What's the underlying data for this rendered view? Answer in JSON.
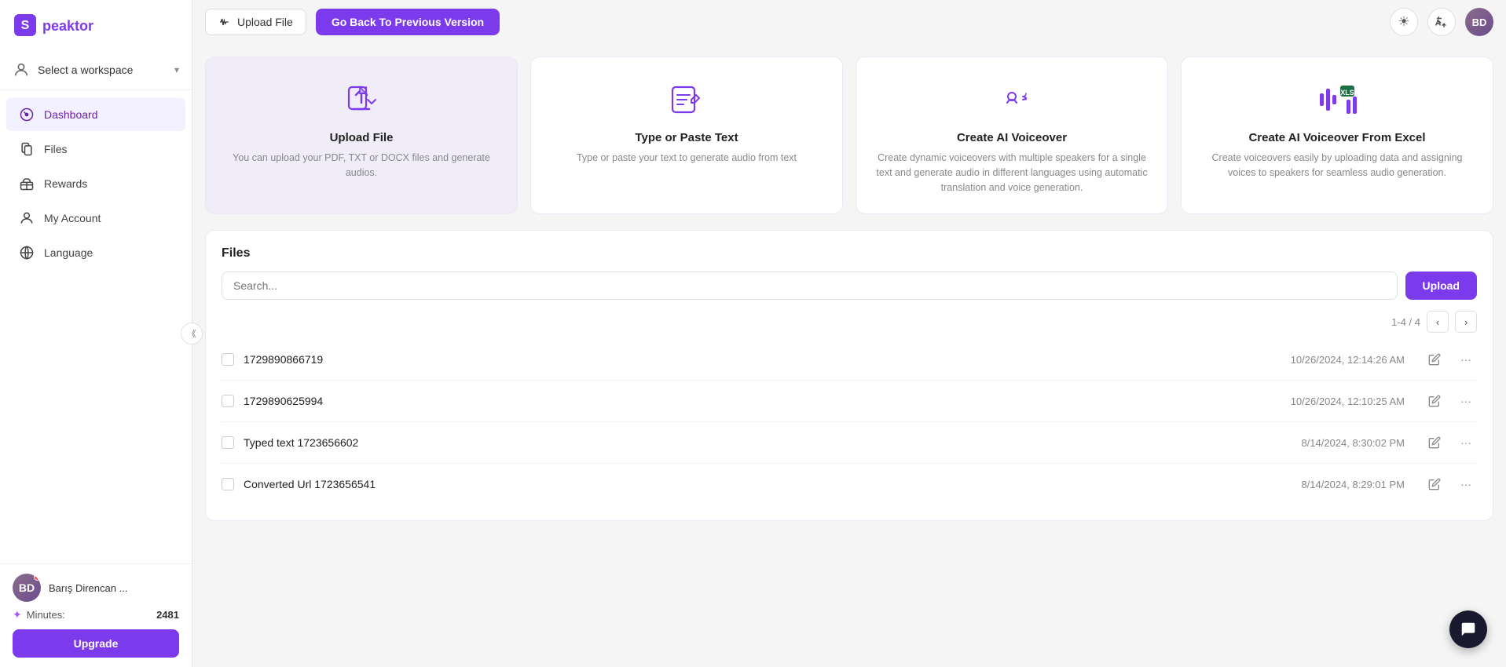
{
  "app": {
    "name": "Speaktor"
  },
  "sidebar": {
    "workspace_label": "Select a workspace",
    "nav_items": [
      {
        "id": "dashboard",
        "label": "Dashboard",
        "active": true
      },
      {
        "id": "files",
        "label": "Files",
        "active": false
      },
      {
        "id": "rewards",
        "label": "Rewards",
        "active": false
      },
      {
        "id": "my-account",
        "label": "My Account",
        "active": false
      },
      {
        "id": "language",
        "label": "Language",
        "active": false
      }
    ],
    "user": {
      "name": "Barış Direncan ...",
      "initials": "BD"
    },
    "minutes_label": "Minutes:",
    "minutes_value": "2481",
    "upgrade_label": "Upgrade"
  },
  "topbar": {
    "upload_file_label": "Upload File",
    "go_back_label": "Go Back To Previous Version"
  },
  "feature_cards": [
    {
      "id": "upload-file",
      "title": "Upload File",
      "description": "You can upload your PDF, TXT or DOCX files and generate audios."
    },
    {
      "id": "type-paste",
      "title": "Type or Paste Text",
      "description": "Type or paste your text to generate audio from text"
    },
    {
      "id": "ai-voiceover",
      "title": "Create AI Voiceover",
      "description": "Create dynamic voiceovers with multiple speakers for a single text and generate audio in different languages using automatic translation and voice generation."
    },
    {
      "id": "ai-voiceover-excel",
      "title": "Create AI Voiceover From Excel",
      "description": "Create voiceovers easily by uploading data and assigning voices to speakers for seamless audio generation."
    }
  ],
  "files_section": {
    "title": "Files",
    "search_placeholder": "Search...",
    "upload_label": "Upload",
    "pagination": "1-4 / 4",
    "files": [
      {
        "id": "1",
        "name": "1729890866719",
        "date": "10/26/2024, 12:14:26 AM"
      },
      {
        "id": "2",
        "name": "1729890625994",
        "date": "10/26/2024, 12:10:25 AM"
      },
      {
        "id": "3",
        "name": "Typed text 1723656602",
        "date": "8/14/2024, 8:30:02 PM"
      },
      {
        "id": "4",
        "name": "Converted Url 1723656541",
        "date": "8/14/2024, 8:29:01 PM"
      }
    ]
  },
  "colors": {
    "brand": "#7c3aed",
    "brand_light": "#f0edf9"
  }
}
